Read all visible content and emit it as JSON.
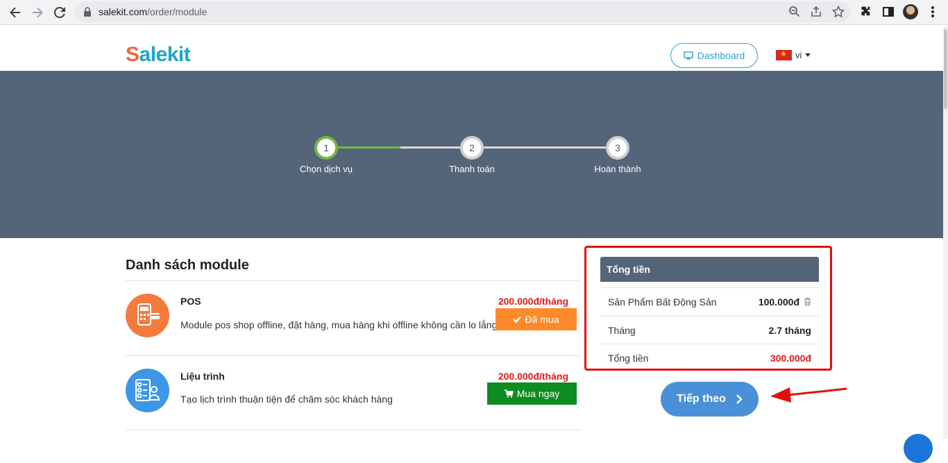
{
  "browser": {
    "url_host": "salekit.com",
    "url_path": "/order/module"
  },
  "header": {
    "logo_part1": "S",
    "logo_part2": "alekit",
    "dashboard_label": "Dashboard",
    "language": "vi"
  },
  "stepper": {
    "steps": [
      {
        "number": "1",
        "label": "Chọn dịch vụ"
      },
      {
        "number": "2",
        "label": "Thanh toán"
      },
      {
        "number": "3",
        "label": "Hoàn thành"
      }
    ]
  },
  "modules": {
    "title": "Danh sách module",
    "items": [
      {
        "name": "POS",
        "description": "Module pos shop offline, đặt hàng, mua hàng khi offline không cần lo lắng",
        "price": "200.000đ/tháng",
        "action": "Đã mua"
      },
      {
        "name": "Liệu trình",
        "description": "Tạo lịch trình thuận tiện để chăm sóc khách hàng",
        "price": "200.000đ/tháng",
        "action": "Mua ngay"
      }
    ]
  },
  "summary": {
    "title": "Tổng tiền",
    "product_label": "Sản Phẩm Bất Động Sản",
    "product_value": "100.000đ",
    "month_label": "Tháng",
    "month_value": "2.7 tháng",
    "total_label": "Tổng tiền",
    "total_value": "300.000đ"
  },
  "next_button": "Tiếp theo",
  "colors": {
    "band": "#556579",
    "accent_green": "#74b843",
    "price_red": "#e01b1b",
    "bought_orange": "#fd8a2a",
    "buy_green": "#0e8b21",
    "next_blue": "#4a90d9",
    "highlight_red": "#e30f0f"
  }
}
